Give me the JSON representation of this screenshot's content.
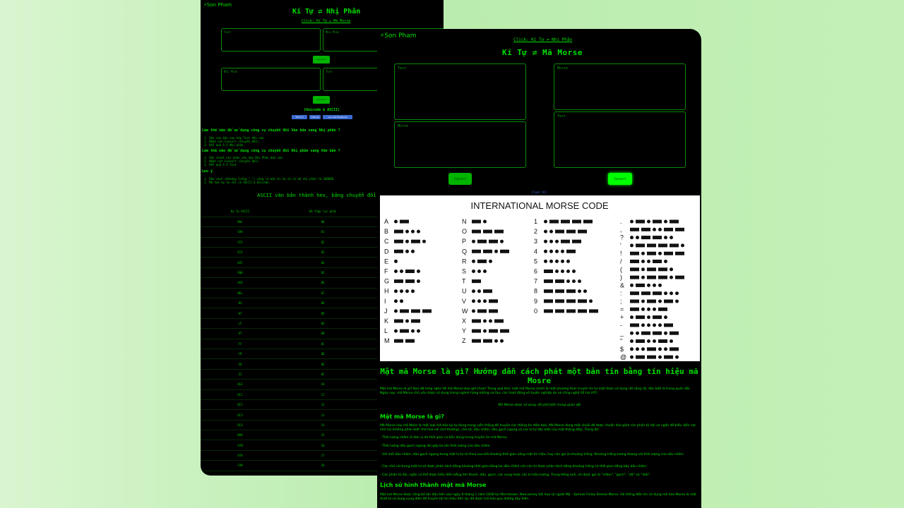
{
  "back": {
    "logo": "Son Pham",
    "title": "Kí Tự ⇌ Nhị Phân",
    "link": "Click: Kí Tự ⇌ Mã Morse",
    "box1_a": "Text",
    "box1_b": "Nhị Phân",
    "btn1": "Convert",
    "box2_a": "Nhị Phân",
    "box2_b": "Text",
    "btn2": "Convert",
    "encoding": "(Unicode & ASCII)",
    "chips": [
      "Thích 3",
      "Chia sẻ",
      "Lưu vào Facebook"
    ],
    "q1": "Làm thế nào để sử dụng công cụ chuyển đổi Văn bản sang Nhị phân ?",
    "q1_steps": [
      "1. Dán văn bản vào hộp Text đầu vào.",
      "2. Nhấn nút Convert (Chuyển đổi).",
      "3. Kết quả ở ô Nhị phân."
    ],
    "q2": "Làm thế nào để sử dụng công cụ chuyển đổi Nhị phân sang Văn bản ?",
    "q2_steps": [
      "1. Dán chuỗi nhị phân vào hộp Nhị Phân đầu vào.",
      "2. Nhấn nút Convert (Chuyển đổi).",
      "3. Kết quả ở ô Text."
    ],
    "q3": "Lưu ý",
    "q3_steps": [
      "1. Dấu cách (khoảng trắng \" \") cũng là một kí tự và có mã nhị phân là 100000.",
      "2. Mã hoá ký tự chỉ có ASCII & Unicode."
    ],
    "table_title": "ASCII văn bản thành hex, bảng chuyển đổi nhị phân",
    "table_headers": [
      "Ký Tự ASCII",
      "Hệ thập lục phân"
    ],
    "table_rows": [
      [
        "NUL",
        "00"
      ],
      [
        "SOH",
        "01"
      ],
      [
        "STX",
        "02"
      ],
      [
        "ETX",
        "03"
      ],
      [
        "EOT",
        "04"
      ],
      [
        "ENQ",
        "05"
      ],
      [
        "ACK",
        "06"
      ],
      [
        "BEL",
        "07"
      ],
      [
        "BS",
        "08"
      ],
      [
        "HT",
        "09"
      ],
      [
        "LF",
        "0A"
      ],
      [
        "VT",
        "0B"
      ],
      [
        "FF",
        "0C"
      ],
      [
        "CR",
        "0D"
      ],
      [
        "SO",
        "0E"
      ],
      [
        "SI",
        "0F"
      ],
      [
        "DLE",
        "10"
      ],
      [
        "DC1",
        "11"
      ],
      [
        "DC2",
        "12"
      ],
      [
        "DC3",
        "13"
      ],
      [
        "DC4",
        "14"
      ],
      [
        "NAK",
        "15"
      ],
      [
        "SYN",
        "16"
      ],
      [
        "ETB",
        "17"
      ],
      [
        "CAN",
        "18"
      ]
    ]
  },
  "front": {
    "logo": "Son Pham",
    "link": "Click: Kí Tự ⇌ Nhị Phân",
    "title": "Kí Tự ⇌ Mã Morse",
    "box_text": "Text",
    "box_morse": "Morse",
    "box_morse2": "Morse",
    "box_text2": "Text",
    "btn_left": "Convert",
    "btn_right": "Convert",
    "clear": "Clear All",
    "chart_title": "INTERNATIONAL MORSE CODE",
    "letters": [
      [
        "A",
        ".-"
      ],
      [
        "B",
        "-..."
      ],
      [
        "C",
        "-.-."
      ],
      [
        "D",
        "-.."
      ],
      [
        "E",
        "."
      ],
      [
        "F",
        "..-."
      ],
      [
        "G",
        "--."
      ],
      [
        "H",
        "...."
      ],
      [
        "I",
        ".."
      ],
      [
        "J",
        ".---"
      ],
      [
        "K",
        "-.-"
      ],
      [
        "L",
        ".-.."
      ],
      [
        "M",
        "--"
      ],
      [
        "N",
        "-."
      ],
      [
        "O",
        "---"
      ],
      [
        "P",
        ".--."
      ],
      [
        "Q",
        "--.-"
      ],
      [
        "R",
        ".-."
      ],
      [
        "S",
        "..."
      ],
      [
        "T",
        "-"
      ],
      [
        "U",
        "..-"
      ],
      [
        "V",
        "...-"
      ],
      [
        "W",
        ".--"
      ],
      [
        "X",
        "-..-"
      ],
      [
        "Y",
        "-.--"
      ],
      [
        "Z",
        "--.."
      ]
    ],
    "digits": [
      [
        "1",
        ".----"
      ],
      [
        "2",
        "..---"
      ],
      [
        "3",
        "...--"
      ],
      [
        "4",
        "....-"
      ],
      [
        "5",
        "....."
      ],
      [
        "6",
        "-...."
      ],
      [
        "7",
        "--..."
      ],
      [
        "8",
        "---.."
      ],
      [
        "9",
        "----."
      ],
      [
        "0",
        "-----"
      ]
    ],
    "symbols": [
      [
        ".",
        ".-.-.-"
      ],
      [
        ",",
        "--..--"
      ],
      [
        "?",
        "..--.."
      ],
      [
        "'",
        ".----."
      ],
      [
        "!",
        "-.-.--"
      ],
      [
        "/",
        "-..-."
      ],
      [
        "(",
        "-.--."
      ],
      [
        ")",
        "-.--.-"
      ],
      [
        "&",
        ".-..."
      ],
      [
        ":",
        "---..."
      ],
      [
        ";",
        "-.-.-."
      ],
      [
        "=",
        "-...-"
      ],
      [
        "+",
        ".-.-."
      ],
      [
        "-",
        "-....-"
      ],
      [
        "_",
        "..--.-"
      ],
      [
        "\"",
        ".-..-."
      ],
      [
        "$",
        "...-..-"
      ],
      [
        "@",
        ".--.-."
      ]
    ],
    "article_title": "Mật mã Morse là gì? Hướng dẫn cách phát một bản tin bằng tín hiệu mã Mosre",
    "intro": "Mật mã Morse là gì? Bạn đã từng nghe tới mã Morse bao giờ chưa? Trong quá khứ, mật mã Morse chính là một phương thức truyền tin tư mật được sử dụng rất rộng rãi, đặc biệt là trong quân đội. Ngày nay, mã Morse chủ yếu được sử dụng trong ngành hàng không và tàu, các hoạt động vô tuyến nghiệp dư và công nghệ hỗ trợ (AT).",
    "caption": "Mã Morse được sử dụng rất phổ biến trong quân đội",
    "h_what": "Mật mã Morse là gì?",
    "what_p": "Mã Morse hay mã Moóc là một loại mã hóa ký tự dùng trong viễn thông để truyền các thông tin điện báo. Mã Morse dùng một chuỗi đã được chuẩn hóa gồm các phần tử dài và ngắn để biểu diễn các chữ cái (không phân biệt chữ hoa với chữ thường), chữ số, dấu chấm, dấu gạch ngang và các kí tự đặc biệt của một thông điệp. Trong đó:",
    "bullets": [
      "- Thời lượng chấm là đơn vị đo thời gian cơ bản dùng trong truyền tin mã Morse.",
      "- Thời lượng dấu gạch ngang dài gấp ba lần thời lượng của dấu chấm.",
      "- Với mỗi dấu chấm, dấu gạch ngang trong một kí tự sẽ theo sau bởi khoảng thời gian vắng mặt tín hiệu, hay còn gọi là khoảng trắng. Khoảng trắng tương đương với thời lượng của dấu chấm.",
      "- Các chữ cái trong một từ sẽ được phân tách bằng khoảng thời gian bằng ba dấu chấm còn các từ được phân tách bằng khoảng trắng có thời gian bằng bảy dấu chấm.",
      "- Các phần tử dài, ngắn có thể được biểu diễn bằng âm thanh, dấu, gạch, các xung hoặc các kí hiệu tương. Trong tiếng anh, nó được gọi là \"chấm\", \"gạch\", \"dit\" và \"dah\"."
    ],
    "h_history": "Lịch sử hình thành mật mã Morse",
    "history_p": "Mật mã Morse được công bố lần đầu tiên vào ngày 6 tháng 1 năm 1838 tại Morristown, New Jersey bởi hoạ sỹ người Mỹ - Samuel Finley Breese Morse. Hệ thống điện tín sử dụng mã hóa Morse là một thiết bị sử dụng xung điện để truyền tải tín hiệu tiến lạc đã được mã hóa qua đường dây điện."
  }
}
